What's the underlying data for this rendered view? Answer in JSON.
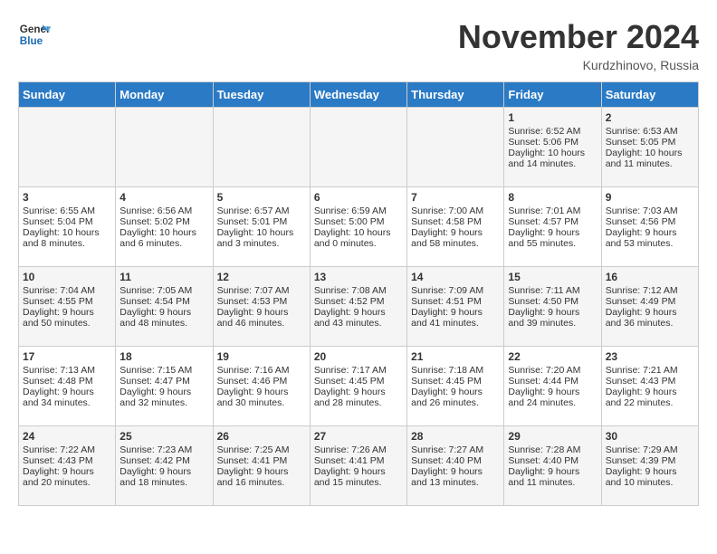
{
  "logo": {
    "line1": "General",
    "line2": "Blue"
  },
  "title": "November 2024",
  "location": "Kurdzhinovo, Russia",
  "days_of_week": [
    "Sunday",
    "Monday",
    "Tuesday",
    "Wednesday",
    "Thursday",
    "Friday",
    "Saturday"
  ],
  "weeks": [
    [
      {
        "day": "",
        "content": ""
      },
      {
        "day": "",
        "content": ""
      },
      {
        "day": "",
        "content": ""
      },
      {
        "day": "",
        "content": ""
      },
      {
        "day": "",
        "content": ""
      },
      {
        "day": "1",
        "content": "Sunrise: 6:52 AM\nSunset: 5:06 PM\nDaylight: 10 hours and 14 minutes."
      },
      {
        "day": "2",
        "content": "Sunrise: 6:53 AM\nSunset: 5:05 PM\nDaylight: 10 hours and 11 minutes."
      }
    ],
    [
      {
        "day": "3",
        "content": "Sunrise: 6:55 AM\nSunset: 5:04 PM\nDaylight: 10 hours and 8 minutes."
      },
      {
        "day": "4",
        "content": "Sunrise: 6:56 AM\nSunset: 5:02 PM\nDaylight: 10 hours and 6 minutes."
      },
      {
        "day": "5",
        "content": "Sunrise: 6:57 AM\nSunset: 5:01 PM\nDaylight: 10 hours and 3 minutes."
      },
      {
        "day": "6",
        "content": "Sunrise: 6:59 AM\nSunset: 5:00 PM\nDaylight: 10 hours and 0 minutes."
      },
      {
        "day": "7",
        "content": "Sunrise: 7:00 AM\nSunset: 4:58 PM\nDaylight: 9 hours and 58 minutes."
      },
      {
        "day": "8",
        "content": "Sunrise: 7:01 AM\nSunset: 4:57 PM\nDaylight: 9 hours and 55 minutes."
      },
      {
        "day": "9",
        "content": "Sunrise: 7:03 AM\nSunset: 4:56 PM\nDaylight: 9 hours and 53 minutes."
      }
    ],
    [
      {
        "day": "10",
        "content": "Sunrise: 7:04 AM\nSunset: 4:55 PM\nDaylight: 9 hours and 50 minutes."
      },
      {
        "day": "11",
        "content": "Sunrise: 7:05 AM\nSunset: 4:54 PM\nDaylight: 9 hours and 48 minutes."
      },
      {
        "day": "12",
        "content": "Sunrise: 7:07 AM\nSunset: 4:53 PM\nDaylight: 9 hours and 46 minutes."
      },
      {
        "day": "13",
        "content": "Sunrise: 7:08 AM\nSunset: 4:52 PM\nDaylight: 9 hours and 43 minutes."
      },
      {
        "day": "14",
        "content": "Sunrise: 7:09 AM\nSunset: 4:51 PM\nDaylight: 9 hours and 41 minutes."
      },
      {
        "day": "15",
        "content": "Sunrise: 7:11 AM\nSunset: 4:50 PM\nDaylight: 9 hours and 39 minutes."
      },
      {
        "day": "16",
        "content": "Sunrise: 7:12 AM\nSunset: 4:49 PM\nDaylight: 9 hours and 36 minutes."
      }
    ],
    [
      {
        "day": "17",
        "content": "Sunrise: 7:13 AM\nSunset: 4:48 PM\nDaylight: 9 hours and 34 minutes."
      },
      {
        "day": "18",
        "content": "Sunrise: 7:15 AM\nSunset: 4:47 PM\nDaylight: 9 hours and 32 minutes."
      },
      {
        "day": "19",
        "content": "Sunrise: 7:16 AM\nSunset: 4:46 PM\nDaylight: 9 hours and 30 minutes."
      },
      {
        "day": "20",
        "content": "Sunrise: 7:17 AM\nSunset: 4:45 PM\nDaylight: 9 hours and 28 minutes."
      },
      {
        "day": "21",
        "content": "Sunrise: 7:18 AM\nSunset: 4:45 PM\nDaylight: 9 hours and 26 minutes."
      },
      {
        "day": "22",
        "content": "Sunrise: 7:20 AM\nSunset: 4:44 PM\nDaylight: 9 hours and 24 minutes."
      },
      {
        "day": "23",
        "content": "Sunrise: 7:21 AM\nSunset: 4:43 PM\nDaylight: 9 hours and 22 minutes."
      }
    ],
    [
      {
        "day": "24",
        "content": "Sunrise: 7:22 AM\nSunset: 4:43 PM\nDaylight: 9 hours and 20 minutes."
      },
      {
        "day": "25",
        "content": "Sunrise: 7:23 AM\nSunset: 4:42 PM\nDaylight: 9 hours and 18 minutes."
      },
      {
        "day": "26",
        "content": "Sunrise: 7:25 AM\nSunset: 4:41 PM\nDaylight: 9 hours and 16 minutes."
      },
      {
        "day": "27",
        "content": "Sunrise: 7:26 AM\nSunset: 4:41 PM\nDaylight: 9 hours and 15 minutes."
      },
      {
        "day": "28",
        "content": "Sunrise: 7:27 AM\nSunset: 4:40 PM\nDaylight: 9 hours and 13 minutes."
      },
      {
        "day": "29",
        "content": "Sunrise: 7:28 AM\nSunset: 4:40 PM\nDaylight: 9 hours and 11 minutes."
      },
      {
        "day": "30",
        "content": "Sunrise: 7:29 AM\nSunset: 4:39 PM\nDaylight: 9 hours and 10 minutes."
      }
    ]
  ]
}
